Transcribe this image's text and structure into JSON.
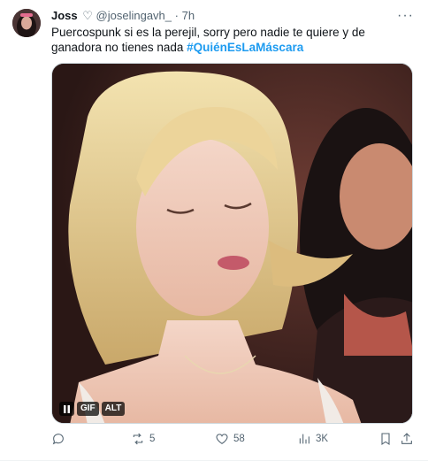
{
  "tweet": {
    "name": "Joss",
    "heart_symbol": "♡",
    "handle": "@joselingavh_",
    "separator": "·",
    "time": "7h",
    "more_symbol": "···",
    "text_plain": "Puercospunk si es la perejil, sorry pero nadie te quiere y de ganadora no tienes nada ",
    "hashtag": "#QuiénEsLaMáscara"
  },
  "media": {
    "badge_gif": "GIF",
    "badge_alt": "ALT"
  },
  "actions": {
    "replies": "",
    "reposts": "5",
    "likes": "58",
    "views": "3K"
  },
  "colors": {
    "link": "#1d9bf0",
    "muted": "#536471"
  },
  "icons": [
    "reply-icon",
    "repost-icon",
    "like-icon",
    "views-icon",
    "bookmark-icon",
    "share-icon",
    "pause-icon"
  ]
}
